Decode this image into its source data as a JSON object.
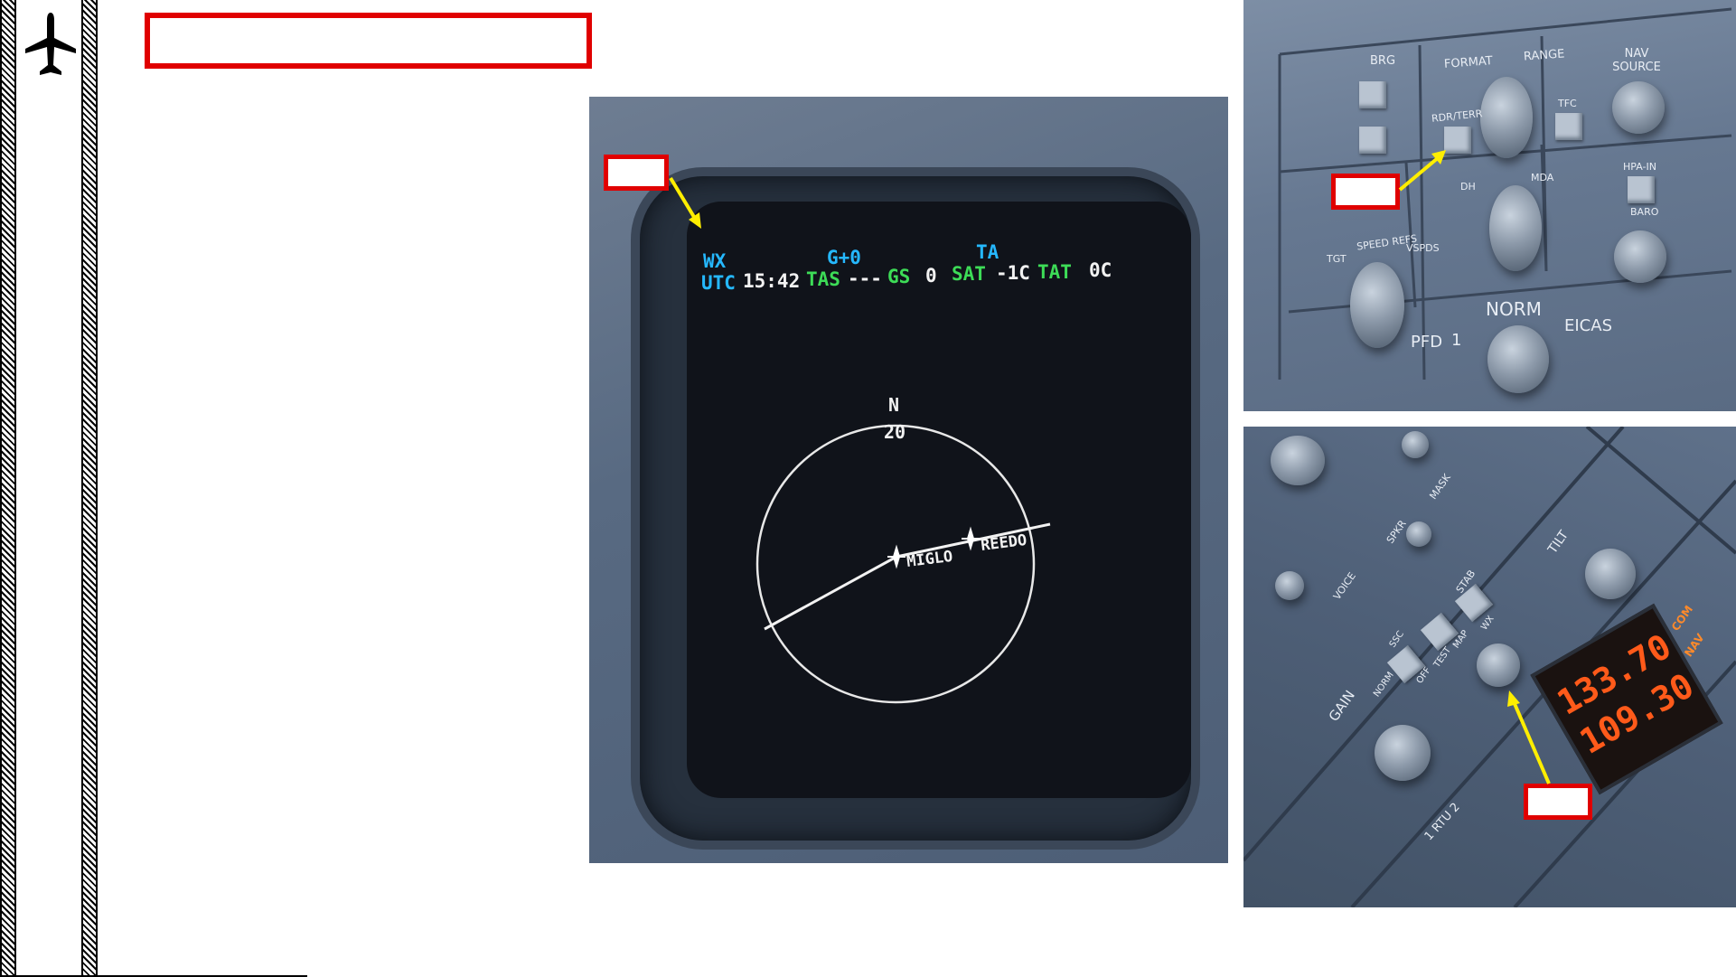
{
  "mfd": {
    "wx": "WX",
    "g": "G+0",
    "ta": "TA",
    "utc_label": "UTC",
    "utc_value": "15:42",
    "tas_label": "TAS",
    "tas_value": "---",
    "gs_label": "GS",
    "gs_value": "0",
    "sat_label": "SAT",
    "sat_value": "-1C",
    "tat_label": "TAT",
    "tat_value": "0C",
    "heading": "N",
    "range": "20",
    "waypoint_1": "MIGLO",
    "waypoint_2": "REEDO"
  },
  "control_panel": {
    "brg": "BRG",
    "format": "FORMAT",
    "range": "RANGE",
    "nav_source": "NAV SOURCE",
    "rdr_terr": "RDR/TERR",
    "tfc": "TFC",
    "dh": "DH",
    "mda": "MDA",
    "hpa_in": "HPA-IN",
    "baro": "BARO",
    "speed_refs": "SPEED REFS",
    "tgt": "TGT",
    "vspds": "VSPDS",
    "norm": "NORM",
    "pfd": "PFD",
    "pfd_num": "1",
    "eicas": "EICAS"
  },
  "radar_panel": {
    "voice": "VOICE",
    "spkr": "SPKR",
    "mask": "MASK",
    "tilt": "TILT",
    "gain": "GAIN",
    "norm": "NORM",
    "stab": "STAB",
    "wx": "WX",
    "map": "MAP",
    "test": "TEST",
    "off": "OFF",
    "ssc": "SSC",
    "rtu": "1 RTU 2",
    "freq_1": "133.70",
    "freq_2": "109.30",
    "com": "COM",
    "nav": "NAV"
  },
  "colors": {
    "callout_red": "#e00000",
    "arrow_yellow": "#ffee00",
    "mfd_cyan": "#25b8ff",
    "mfd_green": "#3ddc57",
    "freq_orange": "#ff5a1a"
  }
}
